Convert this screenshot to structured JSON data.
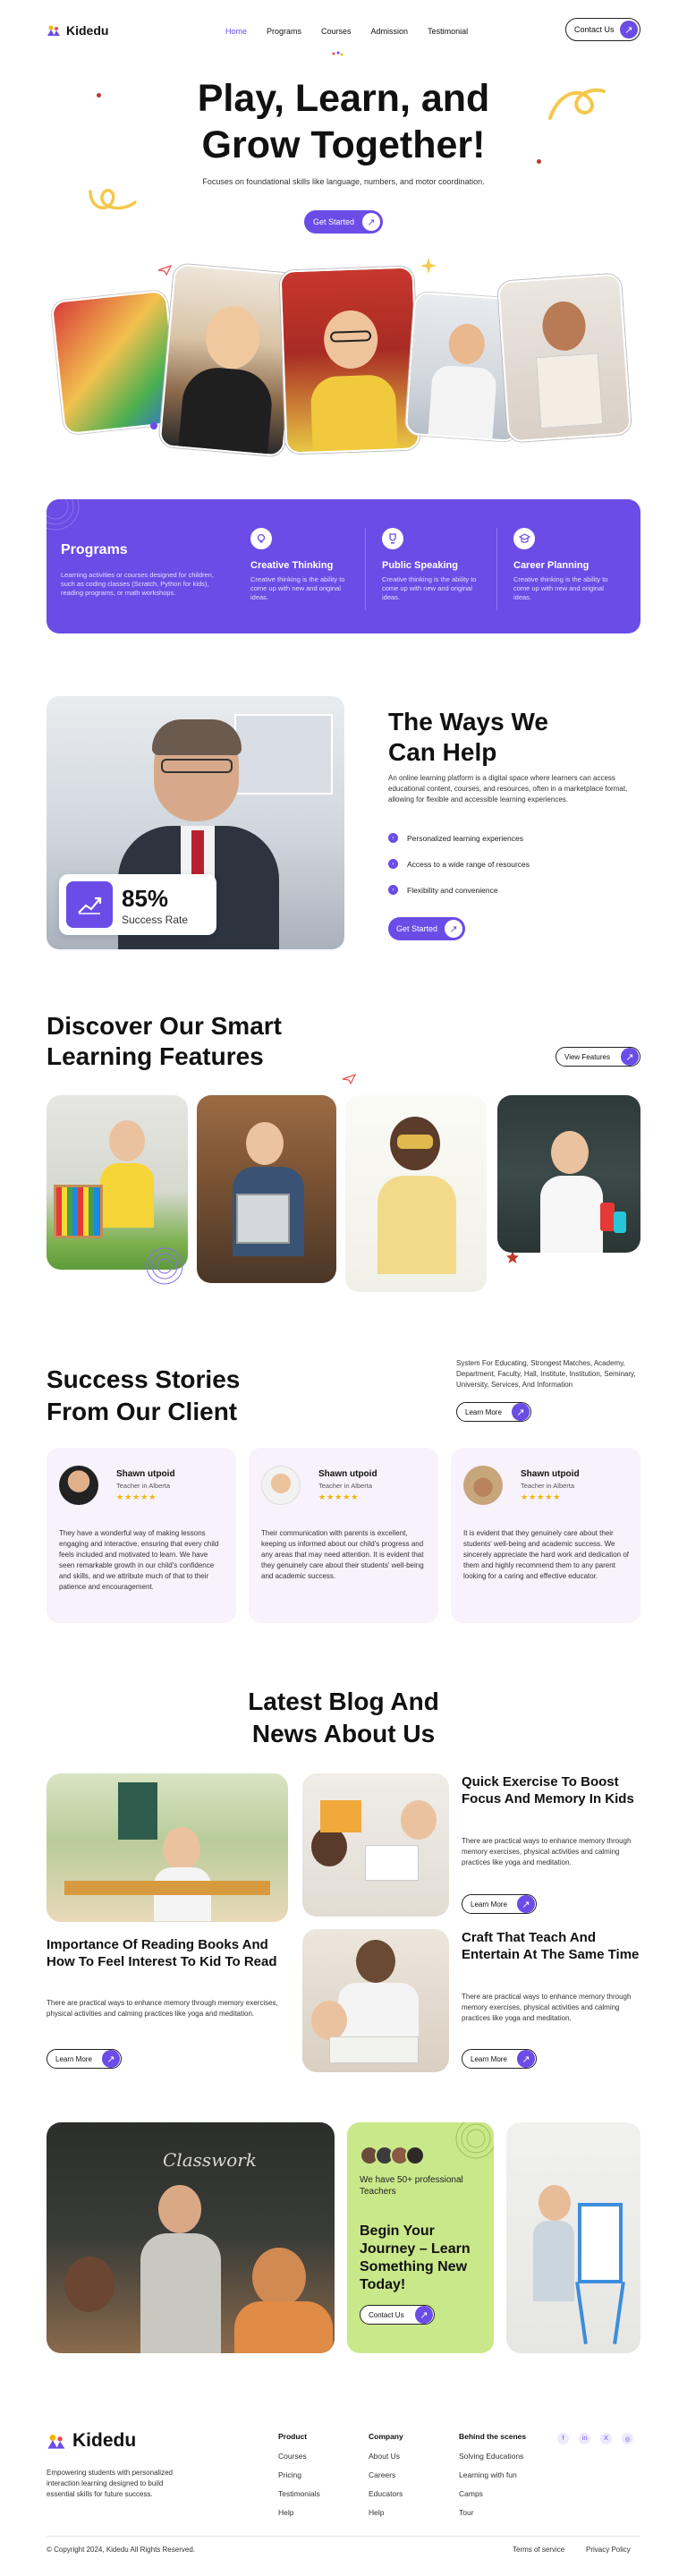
{
  "brand": {
    "name": "Kidedu",
    "accent": "#6B4CE6",
    "lime": "#C9E88A"
  },
  "nav": {
    "items": [
      "Home",
      "Programs",
      "Courses",
      "Admission",
      "Testimonial"
    ],
    "active": "Home",
    "contact_label": "Contact Us"
  },
  "hero": {
    "title_line1": "Play, Learn, and",
    "title_line2": "Grow Together!",
    "subtitle": "Focuses on foundational skills like language, numbers, and motor coordination.",
    "cta": "Get Started"
  },
  "programs_band": {
    "title": "Programs",
    "text": "Learning activities or courses designed for children, such as coding classes (Scratch, Python for kids), reading programs, or math workshops.",
    "items": [
      {
        "icon": "lightbulb-icon",
        "title": "Creative Thinking",
        "text": "Creative thinking is the ability to come up with new and original ideas."
      },
      {
        "icon": "trophy-icon",
        "title": "Public Speaking",
        "text": "Creative thinking is the ability to come up with new and original ideas."
      },
      {
        "icon": "graduation-cap-icon",
        "title": "Career Planning",
        "text": "Creative thinking is the ability to come up with new and original ideas."
      }
    ]
  },
  "ways": {
    "title_line1": "The Ways We",
    "title_line2": "Can Help",
    "text": "An online learning platform is a digital space where learners can access educational content, courses, and resources, often in a marketplace format, allowing for flexible and accessible learning experiences.",
    "bullets": [
      "Personalized learning experiences",
      "Access to a wide range of resources",
      "Flexibility and convenience"
    ],
    "cta": "Get Started",
    "stat_value": "85%",
    "stat_label": "Success Rate"
  },
  "features": {
    "title_line1": "Discover Our Smart",
    "title_line2": "Learning Features",
    "cta": "View Features"
  },
  "stories": {
    "title_line1": "Success Stories",
    "title_line2": "From Our Client",
    "side_text": "System For Educating, Strongest Matches, Academy, Department, Faculty, Hall, Institute, Institution, Seminary, University, Services, And Information",
    "cta": "Learn More",
    "cards": [
      {
        "name": "Shawn utpoid",
        "role": "Teacher in Alberta",
        "stars": "★★★★★",
        "text": "They have a wonderful way of making lessons engaging and interactive, ensuring that every child feels included and motivated to learn. We have seen remarkable growth in our child's confidence and skills, and we attribute much of that to their patience and encouragement."
      },
      {
        "name": "Shawn utpoid",
        "role": "Teacher in Alberta",
        "stars": "★★★★★",
        "text": "Their communication with parents is excellent, keeping us informed about our child's progress and any areas that may need attention. It is evident that they genuinely care about their students' well-being and academic success."
      },
      {
        "name": "Shawn utpoid",
        "role": "Teacher in Alberta",
        "stars": "★★★★★",
        "text": "It is evident that they genuinely care about their students' well-being and academic success. We sincerely appreciate the hard work and dedication of them and highly recommend them to any parent looking for a caring and effective educator."
      }
    ]
  },
  "blog": {
    "title_line1": "Latest Blog And",
    "title_line2": "News About Us",
    "posts": [
      {
        "title": "Importance Of Reading Books And How To Feel Interest To Kid To Read",
        "text": "There are practical ways to enhance memory through memory exercises, physical activities and calming practices like yoga and meditation.",
        "cta": "Learn More"
      },
      {
        "title": "Quick Exercise To Boost Focus And Memory In Kids",
        "text": "There are practical ways to enhance memory through memory exercises, physical activities and calming practices like yoga and meditation.",
        "cta": "Learn More"
      },
      {
        "title": "Craft That Teach And Entertain At The Same Time",
        "text": "There are practical ways to enhance memory through memory exercises, physical activities and calming practices like yoga and meditation.",
        "cta": "Learn More"
      }
    ]
  },
  "journey": {
    "teachers": "We have 50+ professional Teachers",
    "headline": "Begin Your Journey – Learn Something New Today!",
    "cta": "Contact Us",
    "chalk": "Classwork"
  },
  "footer": {
    "brand": "Kidedu",
    "tagline": "Empowering students with personalized interaction learning designed to build essential skills for future success.",
    "columns": [
      {
        "title": "Product",
        "links": [
          "Courses",
          "Pricing",
          "Testimonials",
          "Help"
        ]
      },
      {
        "title": "Company",
        "links": [
          "About Us",
          "Careers",
          "Educators",
          "Help"
        ]
      },
      {
        "title": "Behind the scenes",
        "links": [
          "Solving Educations",
          "Learning with fun",
          "Camps",
          "Tour"
        ]
      }
    ],
    "social": [
      "f",
      "in",
      "X",
      "◎"
    ],
    "copyright": "© Copyright 2024, Kidedu All Rights Reserved.",
    "terms": "Terms of service",
    "privacy": "Privacy Policy"
  }
}
